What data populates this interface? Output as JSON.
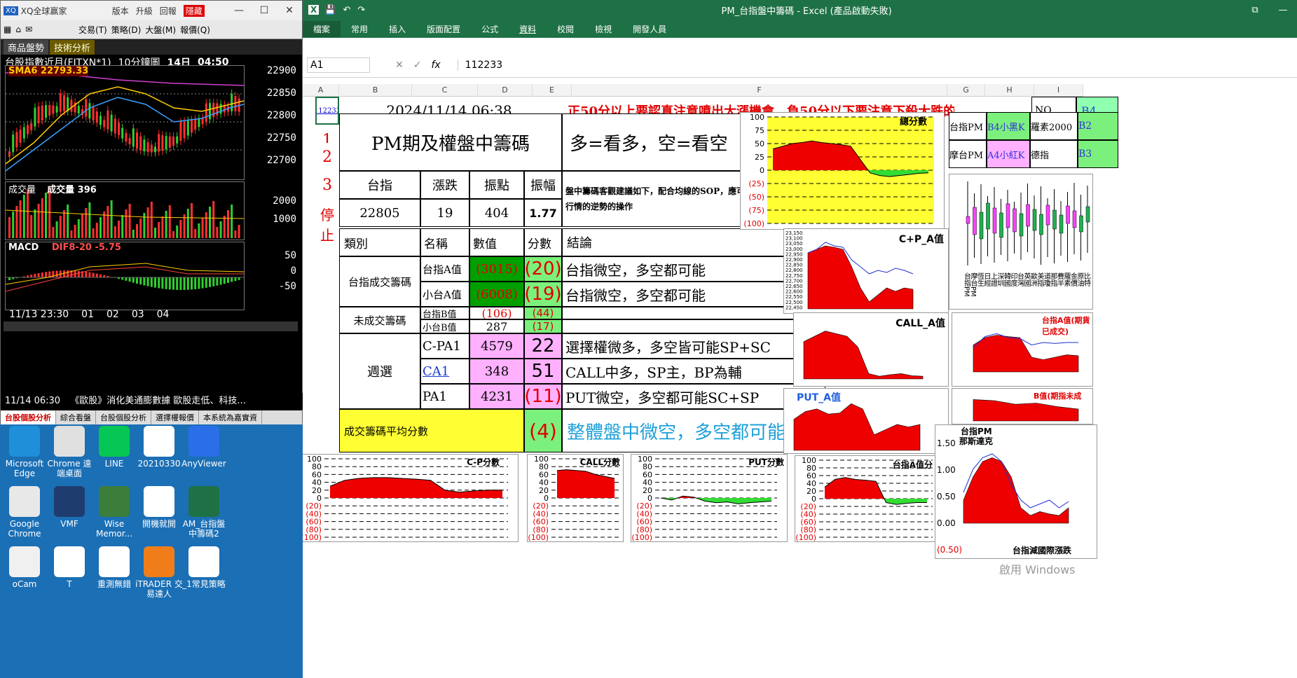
{
  "xq": {
    "title": "XQ全球赢家",
    "menu": [
      "版本",
      "升級",
      "回報",
      "隱藏"
    ],
    "toolbar": [
      "交易(T)",
      "策略(D)",
      "大盤(M)",
      "報價(Q)"
    ],
    "tabs": [
      "商品盤勢",
      "技術分析"
    ],
    "symbol": "台股指數近月(FITXN*1)",
    "period": "10分鐘圖",
    "day": "14日",
    "time": "04:50",
    "sma": "SMA6 22793.33",
    "price_axis": [
      "22900",
      "22850",
      "22800",
      "22750",
      "22700"
    ],
    "vol_label": "成交量",
    "vol_value": "成交量 396",
    "vol_axis": [
      "2000",
      "1000"
    ],
    "macd_label": "MACD",
    "macd_value": "DIF8-20 -5.75",
    "macd_axis": [
      "50",
      "0",
      "-50"
    ],
    "x_axis": [
      "11/13 23:30",
      "01",
      "02",
      "03",
      "04"
    ],
    "news_time": "11/14 06:30",
    "news_text": "《歐股》消化美通膨數據 歐股走低、科技...",
    "bottom_tabs": [
      "台股個股分析",
      "綜合看盤",
      "台股個股分析",
      "選擇權報價",
      "本系統為嘉實資"
    ]
  },
  "desktop": [
    {
      "label": "Microsoft Edge",
      "icon": "edge-icon",
      "color": "#1f8fd9"
    },
    {
      "label": "Chrome 遠端桌面",
      "icon": "chrome-remote-icon",
      "color": "#e0e0e0"
    },
    {
      "label": "LINE",
      "icon": "line-icon",
      "color": "#06c755"
    },
    {
      "label": "20210330",
      "icon": "file-icon",
      "color": "#ffffff"
    },
    {
      "label": "AnyViewer",
      "icon": "anyviewer-icon",
      "color": "#2a6ee8"
    },
    {
      "label": "Google Chrome",
      "icon": "chrome-icon",
      "color": "#e8e8e8"
    },
    {
      "label": "VMF",
      "icon": "vmf-icon",
      "color": "#1f3c6e"
    },
    {
      "label": "Wise Memor...",
      "icon": "wise-icon",
      "color": "#3b7d3b"
    },
    {
      "label": "開機就開",
      "icon": "file-icon",
      "color": "#ffffff"
    },
    {
      "label": "AM_台指盤中籌碼2",
      "icon": "excel-icon",
      "color": "#1e7145"
    },
    {
      "label": "oCam",
      "icon": "ocam-icon",
      "color": "#f0f0f0"
    },
    {
      "label": "T",
      "icon": "file-icon",
      "color": "#ffffff"
    },
    {
      "label": "重測無錯",
      "icon": "file-icon",
      "color": "#ffffff"
    },
    {
      "label": "iTRADER 交易達人",
      "icon": "itrader-icon",
      "color": "#f07d1a"
    },
    {
      "label": "_1常見策略",
      "icon": "file-icon",
      "color": "#ffffff"
    }
  ],
  "excel": {
    "title": "PM_台指盤中籌碼 - Excel (產品啟動失敗)",
    "ribbon": [
      "檔案",
      "常用",
      "插入",
      "版面配置",
      "公式",
      "資料",
      "校閱",
      "檢視",
      "開發人員"
    ],
    "namebox": "A1",
    "formula": "112233",
    "cols": [
      "A",
      "B",
      "C",
      "D",
      "E",
      "F",
      "G",
      "H",
      "I"
    ],
    "a1": "112233",
    "date": "2024/11/14 06:38",
    "warning": "正50分以上要認真注意噴出大漲機會，負50分以下要注意下殺大跌的機會",
    "nq": "NQ",
    "b4": "B4",
    "main_title": "PM期及權盤中籌碼",
    "legend": "多=看多，空=看空",
    "row_nums": [
      "1",
      "2",
      "3"
    ],
    "stop": "停止",
    "hdr": {
      "tx": "台指",
      "chg": "漲跌",
      "range": "振點",
      "amp": "振幅"
    },
    "vals": {
      "tx": "22805",
      "chg": "19",
      "range": "404",
      "amp": "1.77"
    },
    "advice": "盤中籌碼客觀建議如下，配合均線的SOP，應可以避開大行情的逆勢的操作",
    "col_hdr": {
      "type": "類別",
      "name": "名稱",
      "value": "數值",
      "score": "分數",
      "concl": "結論"
    },
    "rows": [
      {
        "name": "台指A值",
        "value": "(3015)",
        "score": "(20)",
        "concl": "台指微空，多空都可能"
      },
      {
        "name": "小台A值",
        "value": "(6008)",
        "score": "(19)",
        "concl": "台指微空，多空都可能"
      },
      {
        "name": "台指B值",
        "value": "(106)",
        "score": "(44)",
        "concl": ""
      },
      {
        "name": "小台B值",
        "value": "287",
        "score": "(17)",
        "concl": ""
      },
      {
        "name": "C-PA1",
        "value": "4579",
        "score": "22",
        "concl": "選擇權微多，多空皆可能SP+SC"
      },
      {
        "name": "CA1",
        "value": "348",
        "score": "51",
        "concl": "CALL中多，SP主，BP為輔"
      },
      {
        "name": "PA1",
        "value": "4231",
        "score": "(11)",
        "concl": "PUT微空，多空都可能SC+SP"
      }
    ],
    "cat1": "台指成交籌碼",
    "cat2": "未成交籌碼",
    "cat3": "週選",
    "avg_label": "成交籌碼平均分數",
    "avg_score": "(4)",
    "avg_concl": "整體盤中微空，多空都可能",
    "side": {
      "pm": "台指PM",
      "b4s": "B4小黑K",
      "russell": "羅素2000",
      "b2": "B2",
      "mtpm": "摩台PM",
      "a4": "A4小紅K",
      "dax": "德指",
      "b3": "B3"
    },
    "vert_labels": [
      "台指PM",
      "摩台PM",
      "恆生",
      "日經",
      "上證",
      "深圳",
      "韓國",
      "印度",
      "台灣",
      "英國",
      "歐洲",
      "美指",
      "道瓊",
      "那指",
      "費半",
      "羅素",
      "金價",
      "原油",
      "比特"
    ],
    "chart_titles": {
      "total": "總分數",
      "cpa": "C+P_A值",
      "call": "CALL_A值",
      "put": "PUT_A值",
      "cp_score": "C-P分數",
      "call_score": "CALL分數",
      "put_score": "PUT分數",
      "txa": "台指A值分",
      "txb": "B值(期指未成交)",
      "txa2": "台指A值(期貨已成交)",
      "pm": "台指PM",
      "nq": "那斯達克",
      "bottom": "台指減國際漲跌"
    },
    "score_axis": [
      "100",
      "80",
      "60",
      "40",
      "20",
      "0",
      "(20)",
      "(40)",
      "(60)",
      "(80)",
      "(100)"
    ],
    "total_axis": [
      "100",
      "75",
      "50",
      "25",
      "0",
      "(25)",
      "(50)",
      "(75)",
      "(100)"
    ],
    "pm_axis": [
      "1.50",
      "1.00",
      "0.50",
      "0.00",
      "(0.50)"
    ],
    "cpa_axis": [
      "23,150",
      "23,100",
      "23,050",
      "23,000",
      "22,950",
      "22,900",
      "22,850",
      "22,800",
      "22,750",
      "22,700",
      "22,650",
      "22,600",
      "22,550",
      "22,500",
      "22,450"
    ],
    "watermark": "啟用 Windows"
  },
  "chart_data": [
    {
      "type": "area",
      "title": "總分數",
      "ylim": [
        -100,
        100
      ],
      "values": [
        40,
        45,
        50,
        52,
        55,
        52,
        50,
        48,
        45,
        20,
        -5,
        -10,
        -12,
        -10,
        -8,
        -6,
        -5
      ]
    },
    {
      "type": "area",
      "title": "C-P分數",
      "ylim": [
        -100,
        100
      ],
      "values": [
        30,
        45,
        50,
        52,
        52,
        50,
        48,
        45,
        20,
        15,
        18,
        20,
        20
      ]
    },
    {
      "type": "area",
      "title": "CALL分數",
      "ylim": [
        -100,
        100
      ],
      "values": [
        70,
        72,
        70,
        68,
        60,
        55,
        50
      ]
    },
    {
      "type": "area",
      "title": "PUT分數",
      "ylim": [
        -100,
        100
      ],
      "values": [
        0,
        -5,
        5,
        2,
        -8,
        -12,
        -10,
        -15,
        -12,
        -10,
        -8
      ]
    },
    {
      "type": "area",
      "title": "台指A值分",
      "ylim": [
        -100,
        100
      ],
      "values": [
        30,
        50,
        55,
        50,
        48,
        45,
        -10,
        -15,
        -12,
        -10,
        -10
      ]
    }
  ]
}
